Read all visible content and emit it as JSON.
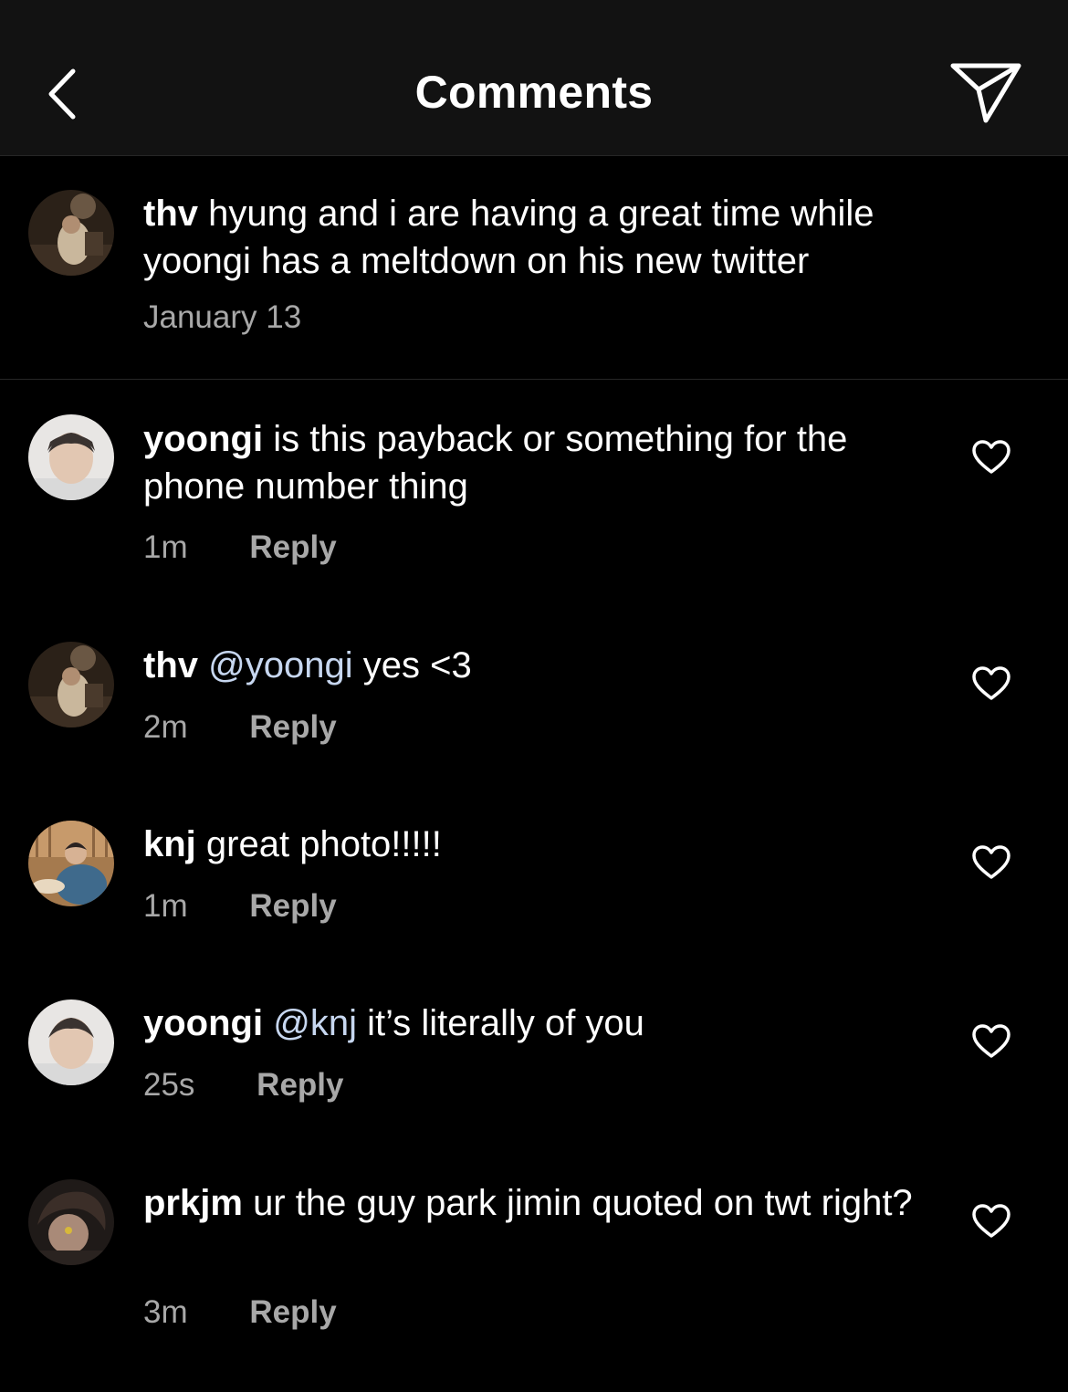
{
  "header": {
    "title": "Comments",
    "back_icon": "chevron-left-icon",
    "share_icon": "paper-plane-icon"
  },
  "caption": {
    "username": "thv",
    "text": "hyung and i are having a great time while yoongi has a meltdown on his new twitter",
    "date": "January 13"
  },
  "comments": [
    {
      "username": "yoongi",
      "mention": "",
      "text": "is this payback or something for the phone number thing",
      "time": "1m",
      "reply_label": "Reply"
    },
    {
      "username": "thv",
      "mention": "@yoongi",
      "text": "yes <3",
      "time": "2m",
      "reply_label": "Reply"
    },
    {
      "username": "knj",
      "mention": "",
      "text": "great photo!!!!!",
      "time": "1m",
      "reply_label": "Reply"
    },
    {
      "username": "yoongi",
      "mention": "@knj",
      "text": "it’s literally of you",
      "time": "25s",
      "reply_label": "Reply"
    },
    {
      "username": "prkjm",
      "mention": "",
      "text": "ur the guy park jimin quoted on twt right?",
      "time": "3m",
      "reply_label": "Reply"
    }
  ],
  "colors": {
    "background": "#000000",
    "header": "#121212",
    "secondary_text": "#a8a8a8",
    "mention": "#c7d7f0"
  }
}
